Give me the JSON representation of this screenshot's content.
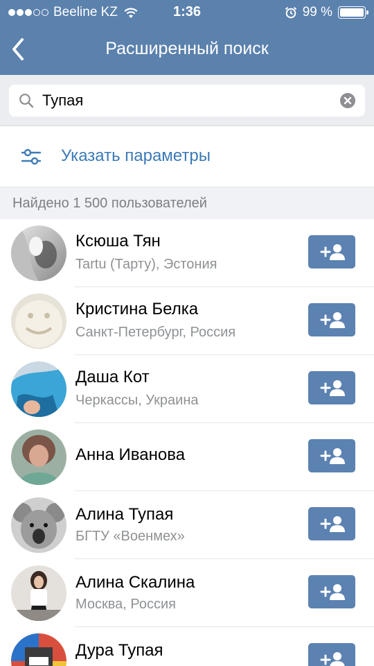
{
  "status_bar": {
    "carrier": "Beeline KZ",
    "time": "1:36",
    "battery": "99 %",
    "battery_level": 0.99,
    "signal_bars_filled": 3,
    "signal_bars_total": 5
  },
  "nav": {
    "title": "Расширенный поиск",
    "back_icon": "chevron-left-icon"
  },
  "search": {
    "value": "Тупая",
    "placeholder": "Поиск"
  },
  "params": {
    "label": "Указать параметры",
    "icon": "sliders-icon"
  },
  "results": {
    "count_label": "Найдено 1 500 пользователей"
  },
  "users": [
    {
      "name": "Ксюша Тян",
      "subtitle": "Tartu (Тарту), Эстония"
    },
    {
      "name": "Кристина Белка",
      "subtitle": "Санкт-Петербург, Россия"
    },
    {
      "name": "Даша Кот",
      "subtitle": "Черкассы, Украина"
    },
    {
      "name": "Анна Иванова",
      "subtitle": ""
    },
    {
      "name": "Алина Тупая",
      "subtitle": "БГТУ «Военмех»"
    },
    {
      "name": "Алина Скалина",
      "subtitle": "Москва, Россия"
    },
    {
      "name": "Дура Тупая",
      "subtitle": ""
    }
  ],
  "colors": {
    "header": "#5b81ad",
    "link": "#3c7ab8",
    "add_button": "#5b82b1",
    "secondary_text": "#8e9194"
  }
}
